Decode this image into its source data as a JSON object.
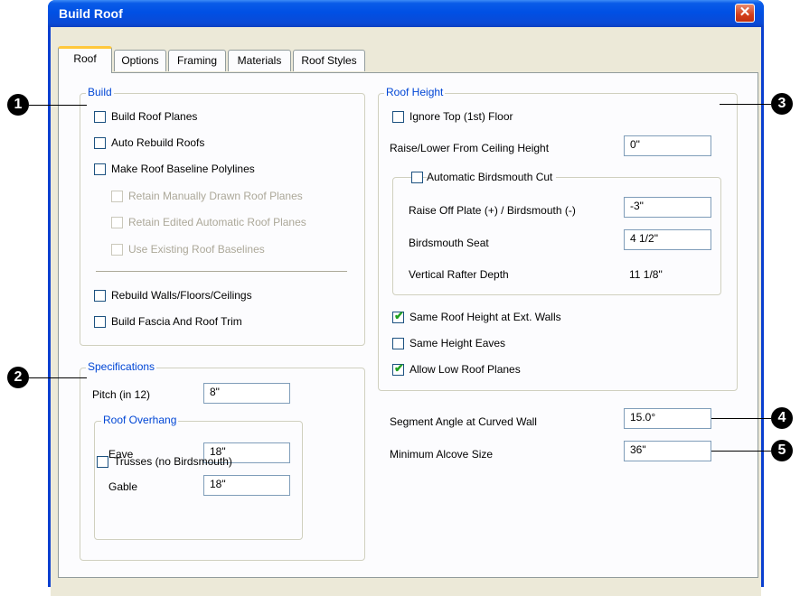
{
  "window": {
    "title": "Build Roof",
    "close_glyph": "✕"
  },
  "tabs": [
    "Roof",
    "Options",
    "Framing",
    "Materials",
    "Roof Styles"
  ],
  "build": {
    "legend": "Build",
    "build_roof_planes": "Build Roof Planes",
    "auto_rebuild_roofs": "Auto Rebuild Roofs",
    "make_roof_baseline_polylines": "Make Roof Baseline Polylines",
    "retain_manually_drawn": "Retain Manually Drawn Roof Planes",
    "retain_edited_automatic": "Retain Edited Automatic Roof Planes",
    "use_existing_baselines": "Use Existing Roof Baselines",
    "rebuild_walls": "Rebuild Walls/Floors/Ceilings",
    "build_fascia": "Build Fascia And Roof Trim"
  },
  "specifications": {
    "legend": "Specifications",
    "pitch_label": "Pitch (in 12)",
    "pitch_value": "8\"",
    "overhang_legend": "Roof Overhang",
    "eave_label": "Eave",
    "eave_value": "18\"",
    "gable_label": "Gable",
    "gable_value": "18\"",
    "trusses": "Trusses (no Birdsmouth)"
  },
  "roof_height": {
    "legend": "Roof Height",
    "ignore_top_floor": "Ignore Top (1st) Floor",
    "raise_lower_label": "Raise/Lower From Ceiling Height",
    "raise_lower_value": "0\"",
    "auto_birdsmouth": "Automatic Birdsmouth Cut",
    "raise_off_plate_label": "Raise Off Plate (+) / Birdsmouth (-)",
    "raise_off_plate_value": "-3\"",
    "birdsmouth_seat_label": "Birdsmouth Seat",
    "birdsmouth_seat_value": "4 1/2\"",
    "vertical_rafter_label": "Vertical Rafter Depth",
    "vertical_rafter_value": "11 1/8\"",
    "same_roof_height": "Same Roof Height at Ext. Walls",
    "same_height_eaves": "Same Height Eaves",
    "allow_low_roof": "Allow Low Roof Planes"
  },
  "segment_angle": {
    "label": "Segment Angle at Curved Wall",
    "value": "15.0°"
  },
  "min_alcove": {
    "label": "Minimum Alcove Size",
    "value": "36\""
  },
  "callouts": [
    "1",
    "2",
    "3",
    "4",
    "5"
  ],
  "checked": {
    "same_roof_height": true,
    "allow_low_roof": true
  },
  "tick_glyph": "✔"
}
